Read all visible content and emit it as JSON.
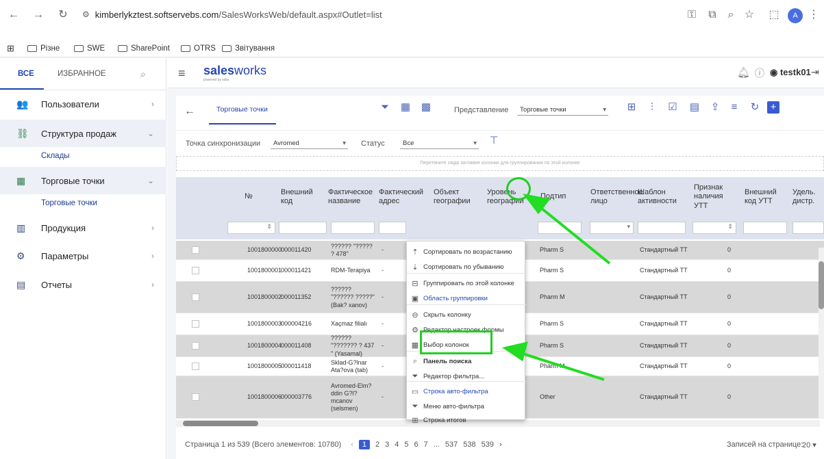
{
  "browser": {
    "url_host": "kimberlykztest.softservebs.com",
    "url_path": "/SalesWorksWeb/default.aspx#Outlet=list",
    "avatar_letter": "A",
    "bookmarks": [
      "Різне",
      "SWE",
      "SharePoint",
      "OTRS",
      "Звітування"
    ]
  },
  "sidebar": {
    "tab_all": "ВСЕ",
    "tab_favorites": "ИЗБРАННОЕ",
    "items": [
      {
        "label": "Пользователи"
      },
      {
        "label": "Структура продаж"
      },
      {
        "label": "Склады"
      },
      {
        "label": "Торговые точки"
      },
      {
        "label": "Торговые точки"
      },
      {
        "label": "Продукция"
      },
      {
        "label": "Параметры"
      },
      {
        "label": "Отчеты"
      }
    ]
  },
  "header": {
    "logo_bold": "sales",
    "logo_rest": "works",
    "logo_sub": "powered by ssbs",
    "user": "testk01"
  },
  "toolbar": {
    "tab": "Торговые точки",
    "view_label": "Представление",
    "view_value": "Торговые точки"
  },
  "filters": {
    "sync_label": "Точка синхронизации",
    "sync_value": "Avromed",
    "status_label": "Статус",
    "status_value": "Все",
    "group_hint": "Перетяните сюда заглавие колонки для группирования по этой колонке"
  },
  "columns": [
    "№",
    "Внешний код",
    "Фактическое название",
    "Фактический адрес",
    "Объект географии",
    "Уровень географии",
    "Подтип",
    "Ответственное лицо",
    "Шаблон активности",
    "Признак наличия УТТ",
    "Внешний код УТТ",
    "Удель. дистр."
  ],
  "rows": [
    {
      "no": "1001800000",
      "code": "000011420",
      "name": "?????? \"????? ? 478\"",
      "addr": "-",
      "subtype": "Pharm S",
      "template": "Стандартный ТТ",
      "utt": "0"
    },
    {
      "no": "1001800001",
      "code": "000011421",
      "name": "RDM-Terapiya",
      "addr": "-",
      "subtype": "Pharm S",
      "template": "Стандартный ТТ",
      "utt": "0"
    },
    {
      "no": "1001800002",
      "code": "000011352",
      "name": "?????? \"?????? ?????\"(Bak? xanov)",
      "addr": "-",
      "subtype": "Pharm M",
      "template": "Стандартный ТТ",
      "utt": "0"
    },
    {
      "no": "1001800003",
      "code": "000004216",
      "name": "Xaçmaz filialı",
      "addr": "-",
      "subtype": "Pharm S",
      "template": "Стандартный ТТ",
      "utt": "0"
    },
    {
      "no": "1001800004",
      "code": "000011408",
      "name": "?????? \"??????? ? 437 \" (Yasamal)",
      "addr": "-",
      "subtype": "Pharm S",
      "template": "Стандартный ТТ",
      "utt": "0"
    },
    {
      "no": "1001800005",
      "code": "000011418",
      "name": "Sklad-G?lnar Ata?ova (tab)",
      "addr": "-",
      "subtype": "Pharm M",
      "template": "Стандартный ТТ",
      "utt": "0"
    },
    {
      "no": "1001800006",
      "code": "000003776",
      "name": "Avromed-Elm? ddin G?l? mcanov (selsmen)",
      "addr": "-",
      "subtype": "Other",
      "template": "Стандартный ТТ",
      "utt": "0"
    }
  ],
  "context_menu": [
    {
      "label": "Сортировать по возрастанию",
      "icon": "sort-asc-icon",
      "blue": false
    },
    {
      "label": "Сортировать по убыванию",
      "icon": "sort-desc-icon",
      "blue": false
    },
    {
      "label": "Группировать по этой колонке",
      "icon": "group-icon",
      "blue": false
    },
    {
      "label": "Область группировки",
      "icon": "group-area-icon",
      "blue": true
    },
    {
      "label": "Скрыть колонку",
      "icon": "hide-icon",
      "blue": false
    },
    {
      "label": "Редактор настроек формы",
      "icon": "form-settings-icon",
      "blue": false
    },
    {
      "label": "Выбор колонок",
      "icon": "columns-icon",
      "blue": false
    },
    {
      "label": "Панель поиска",
      "icon": "search-icon",
      "blue": false
    },
    {
      "label": "Редактор фильтра...",
      "icon": "filter-editor-icon",
      "blue": false
    },
    {
      "label": "Строка авто-фильтра",
      "icon": "autofilter-row-icon",
      "blue": true
    },
    {
      "label": "Меню авто-фильтра",
      "icon": "autofilter-menu-icon",
      "blue": false
    },
    {
      "label": "Строка итогов",
      "icon": "totals-row-icon",
      "blue": false
    }
  ],
  "pager": {
    "summary": "Страница 1 из 539 (Всего элементов: 10780)",
    "pages": [
      "1",
      "2",
      "3",
      "4",
      "5",
      "6",
      "7",
      "...",
      "537",
      "538",
      "539"
    ],
    "per_page_label": "Записей на странице:",
    "per_page_value": "20"
  },
  "colors": {
    "accent": "#3a5bd0",
    "highlight": "#22cc22",
    "header_bg": "#dde2ee"
  }
}
